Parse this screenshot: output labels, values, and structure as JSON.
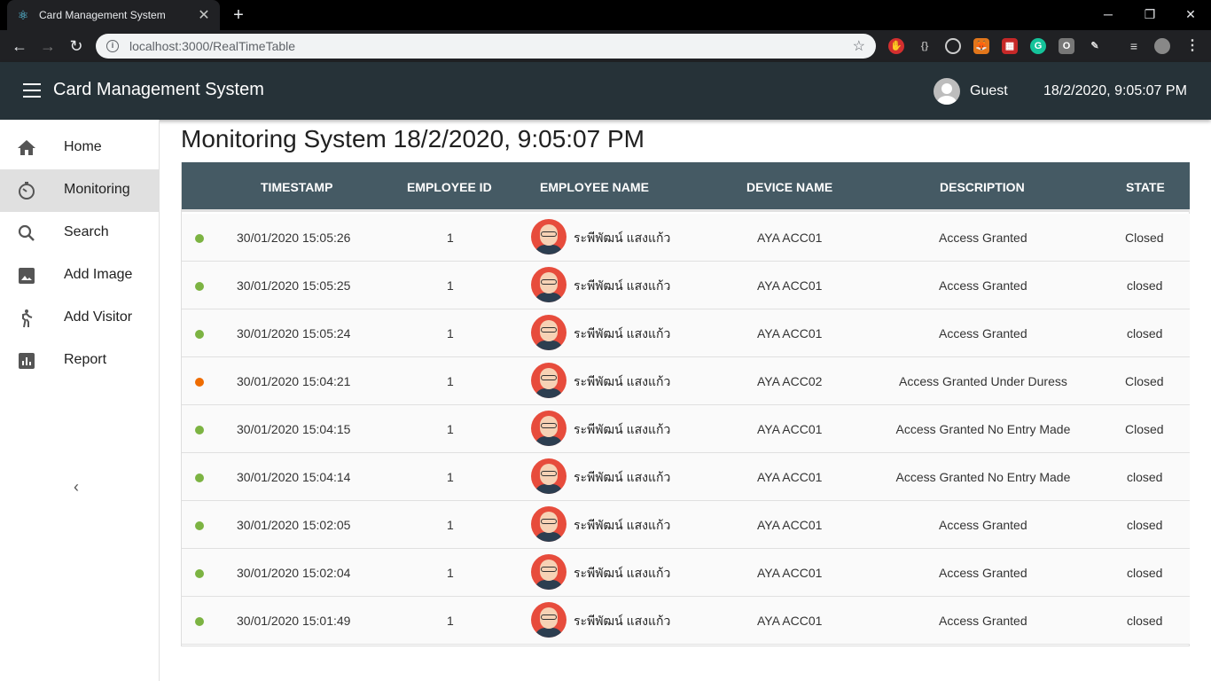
{
  "browser": {
    "tab_title": "Card Management System",
    "url": "localhost:3000/RealTimeTable"
  },
  "app": {
    "title": "Card Management System",
    "user": "Guest",
    "datetime": "18/2/2020, 9:05:07 PM"
  },
  "sidebar": {
    "items": [
      {
        "label": "Home",
        "icon": "home-icon"
      },
      {
        "label": "Monitoring",
        "icon": "timer-icon",
        "active": true
      },
      {
        "label": "Search",
        "icon": "search-icon"
      },
      {
        "label": "Add Image",
        "icon": "image-icon"
      },
      {
        "label": "Add Visitor",
        "icon": "person-walking-icon"
      },
      {
        "label": "Report",
        "icon": "bar-chart-icon"
      }
    ]
  },
  "main": {
    "title": "Monitoring System 18/2/2020, 9:05:07 PM",
    "columns": [
      "TIMESTAMP",
      "EMPLOYEE ID",
      "EMPLOYEE NAME",
      "DEVICE NAME",
      "DESCRIPTION",
      "STATE"
    ],
    "rows": [
      {
        "status": "green",
        "timestamp": "30/01/2020  15:05:26",
        "employee_id": "1",
        "employee_name": "ระพีพัฒน์ แสงแก้ว",
        "device": "AYA ACC01",
        "description": "Access Granted",
        "state": "Closed"
      },
      {
        "status": "green",
        "timestamp": "30/01/2020  15:05:25",
        "employee_id": "1",
        "employee_name": "ระพีพัฒน์ แสงแก้ว",
        "device": "AYA ACC01",
        "description": "Access Granted",
        "state": "closed"
      },
      {
        "status": "green",
        "timestamp": "30/01/2020  15:05:24",
        "employee_id": "1",
        "employee_name": "ระพีพัฒน์ แสงแก้ว",
        "device": "AYA ACC01",
        "description": "Access Granted",
        "state": "closed"
      },
      {
        "status": "orange",
        "timestamp": "30/01/2020  15:04:21",
        "employee_id": "1",
        "employee_name": "ระพีพัฒน์ แสงแก้ว",
        "device": "AYA ACC02",
        "description": "Access Granted Under Duress",
        "state": "Closed"
      },
      {
        "status": "green",
        "timestamp": "30/01/2020  15:04:15",
        "employee_id": "1",
        "employee_name": "ระพีพัฒน์ แสงแก้ว",
        "device": "AYA ACC01",
        "description": "Access Granted No Entry Made",
        "state": "Closed"
      },
      {
        "status": "green",
        "timestamp": "30/01/2020  15:04:14",
        "employee_id": "1",
        "employee_name": "ระพีพัฒน์ แสงแก้ว",
        "device": "AYA ACC01",
        "description": "Access Granted No Entry Made",
        "state": "closed"
      },
      {
        "status": "green",
        "timestamp": "30/01/2020  15:02:05",
        "employee_id": "1",
        "employee_name": "ระพีพัฒน์ แสงแก้ว",
        "device": "AYA ACC01",
        "description": "Access Granted",
        "state": "closed"
      },
      {
        "status": "green",
        "timestamp": "30/01/2020  15:02:04",
        "employee_id": "1",
        "employee_name": "ระพีพัฒน์ แสงแก้ว",
        "device": "AYA ACC01",
        "description": "Access Granted",
        "state": "closed"
      },
      {
        "status": "green",
        "timestamp": "30/01/2020  15:01:49",
        "employee_id": "1",
        "employee_name": "ระพีพัฒน์ แสงแก้ว",
        "device": "AYA ACC01",
        "description": "Access Granted",
        "state": "closed"
      }
    ]
  },
  "colors": {
    "appbar": "#263238",
    "table_header": "#455a64",
    "status_green": "#7cb342",
    "status_orange": "#ef6c00",
    "avatar_red": "#e74c3c"
  }
}
